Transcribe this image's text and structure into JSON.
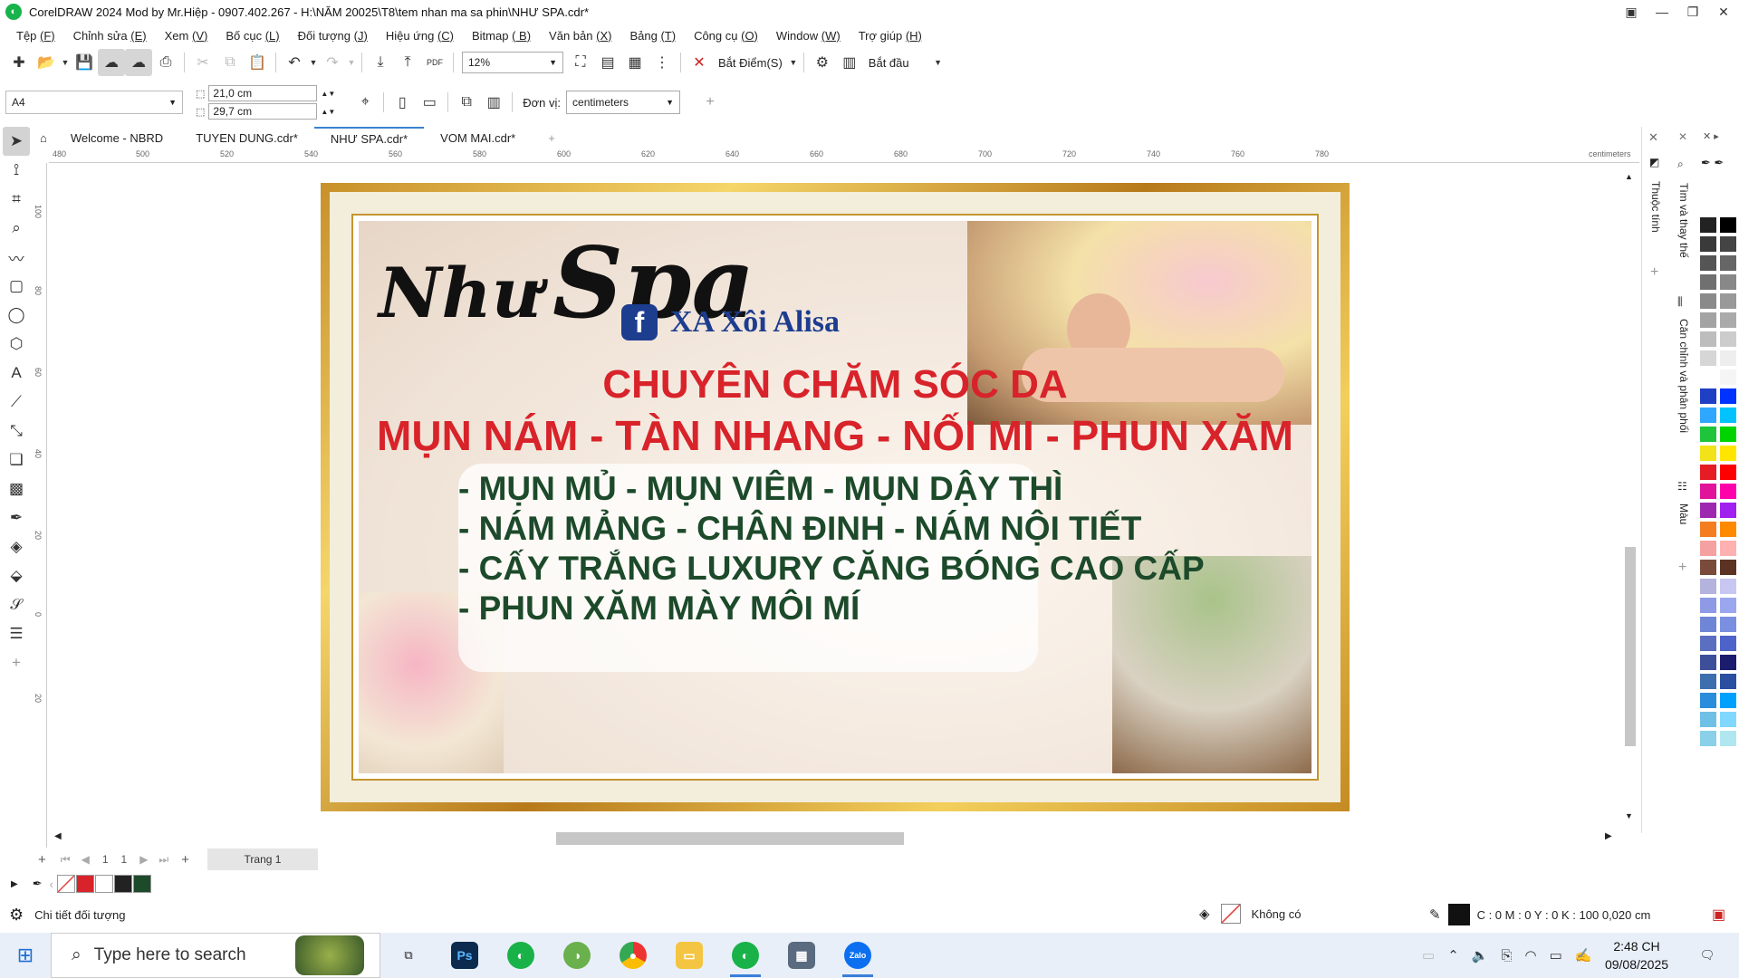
{
  "window": {
    "title": "CorelDRAW 2024 Mod by Mr.Hiệp - 0907.402.267 - H:\\NĂM 20025\\T8\\tem nhan ma sa phin\\NHƯ SPA.cdr*"
  },
  "menu": [
    {
      "label": "Tệp",
      "key": "(F)"
    },
    {
      "label": "Chỉnh sửa",
      "key": "(E)"
    },
    {
      "label": "Xem",
      "key": "(V)"
    },
    {
      "label": "Bố cục",
      "key": "(L)"
    },
    {
      "label": "Đối tượng",
      "key": "(J)"
    },
    {
      "label": "Hiệu ứng",
      "key": "(C)"
    },
    {
      "label": "Bitmap",
      "key": "( B)"
    },
    {
      "label": "Văn bản",
      "key": "(X)"
    },
    {
      "label": "Bảng",
      "key": "(T)"
    },
    {
      "label": "Công cụ",
      "key": "(O)"
    },
    {
      "label": "Window",
      "key": "(W)"
    },
    {
      "label": "Trợ giúp",
      "key": "(H)"
    }
  ],
  "toolbar": {
    "zoom": "12%",
    "pdf_label": "PDF",
    "snap_label": "Bắt Điểm(S)",
    "launch_label": "Bắt đầu"
  },
  "propbar": {
    "page_size": "A4",
    "width": "21,0 cm",
    "height": "29,7 cm",
    "unit_label": "Đơn vị:",
    "unit": "centimeters"
  },
  "tabs": [
    "Welcome - NBRD",
    "TUYEN DUNG.cdr*",
    "NHƯ SPA.cdr*",
    "VOM MAI.cdr*"
  ],
  "ruler": {
    "h_ticks": [
      "480",
      "500",
      "520",
      "540",
      "560",
      "580",
      "600",
      "620",
      "640",
      "660",
      "680",
      "700",
      "720",
      "740",
      "760",
      "780"
    ],
    "unit": "centimeters",
    "v_ticks": [
      "100",
      "80",
      "60",
      "40",
      "20",
      "0",
      "20"
    ]
  },
  "banner": {
    "logo_nhu": "Như",
    "logo_spa": "Spa",
    "fb_icon": "f",
    "fb_name": "XA Xôi Alisa",
    "headline1": "CHUYÊN CHĂM SÓC DA",
    "headline2": "MỤN NÁM - TÀN NHANG - NỐI MI - PHUN XĂM",
    "services": [
      "- MỤN MỦ - MỤN VIÊM - MỤN DẬY THÌ",
      "- NÁM MẢNG - CHÂN ĐINH - NÁM NỘI TIẾT",
      "- CẤY TRẮNG LUXURY CĂNG BÓNG CAO CẤP",
      "- PHUN XĂM MÀY MÔI MÍ"
    ]
  },
  "dockers": {
    "properties": "Thuộc tính",
    "find_replace": "Tìm và thay thế",
    "align": "Căn chỉnh và phân phối",
    "color": "Màu"
  },
  "pagenav": {
    "current": "1",
    "total": "1",
    "page_tab": "Trang 1"
  },
  "status": {
    "object_details": "Chi tiết đối tượng",
    "fill": "Không có",
    "outline": "C : 0 M : 0 Y : 0 K : 100  0,020 cm"
  },
  "taskbar": {
    "search_placeholder": "Type here to search",
    "time": "2:48 CH",
    "date": "09/08/2025",
    "ps_label": "Ps",
    "zalo_label": "Zalo"
  },
  "colors": {
    "accent": "#3a82d0",
    "headline": "#d8232a",
    "list": "#1c4a2a",
    "facebook": "#1d3d8f"
  }
}
